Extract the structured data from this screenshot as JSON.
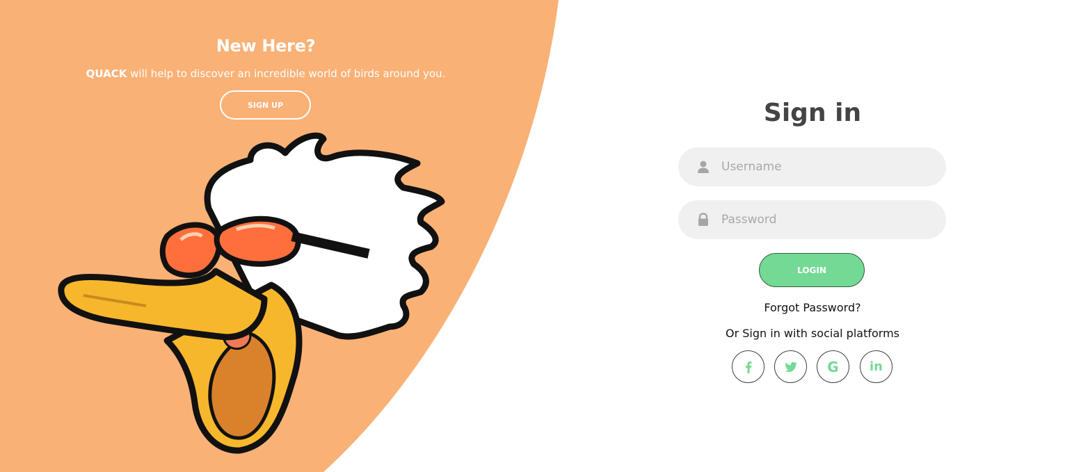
{
  "promo": {
    "title": "New Here?",
    "brand": "QUACK",
    "description": " will help to discover an incredible world of birds around you.",
    "signup_label": "SIGN UP"
  },
  "signin": {
    "title": "Sign in",
    "username_placeholder": "Username",
    "password_placeholder": "Password",
    "login_label": "LOGIN",
    "forgot_label": "Forgot Password?",
    "social_label": "Or Sign in with social platforms"
  },
  "social": {
    "google_glyph": "G",
    "linkedin_glyph": "in"
  },
  "icons": [
    "user-icon",
    "lock-icon",
    "facebook-icon",
    "twitter-icon",
    "google-icon",
    "linkedin-icon"
  ],
  "colors": {
    "panel": "#f9b176",
    "accent": "#74d995",
    "title": "#444444",
    "field_bg": "#f0f0f0"
  }
}
